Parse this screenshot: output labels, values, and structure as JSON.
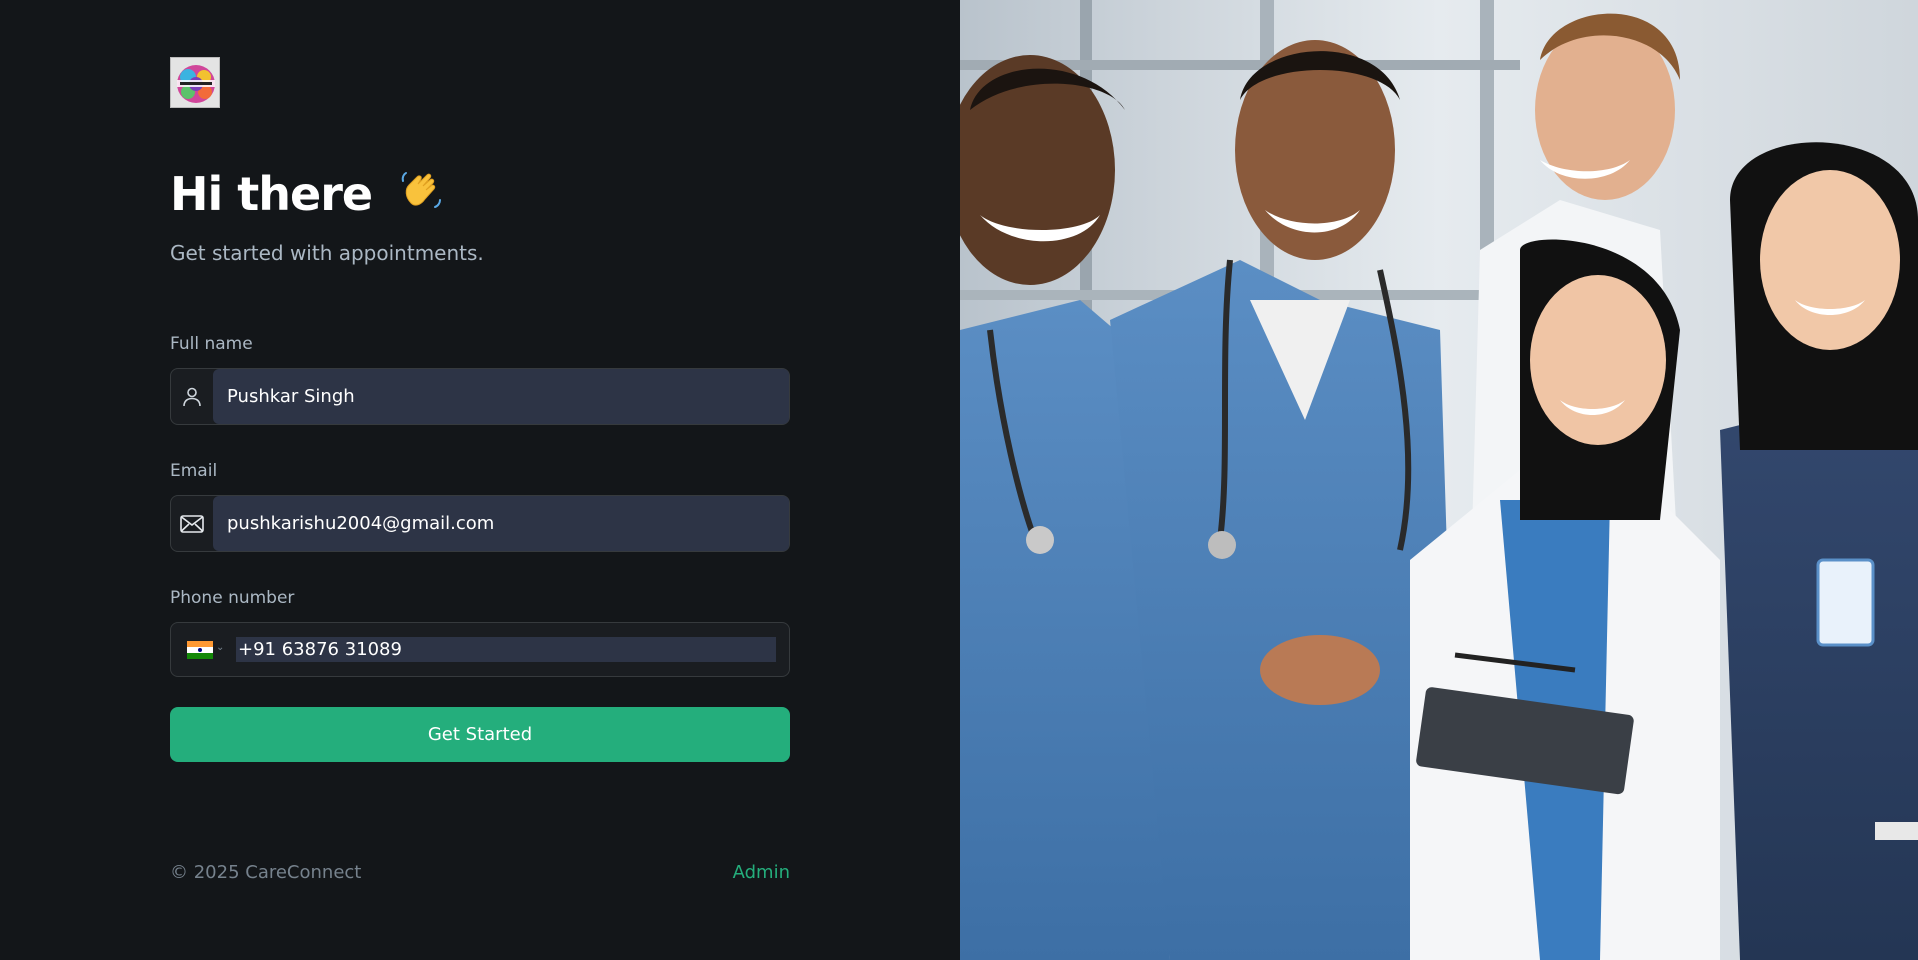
{
  "brand": {
    "logo_alt": "CareConnect logo"
  },
  "hero": {
    "title": "Hi there",
    "wave_icon": "waving-hand-icon",
    "subtitle": "Get started with appointments."
  },
  "form": {
    "full_name": {
      "label": "Full name",
      "value": "Pushkar Singh",
      "icon": "user-icon"
    },
    "email": {
      "label": "Email",
      "value": "pushkarishu2004@gmail.com",
      "icon": "mail-icon"
    },
    "phone": {
      "label": "Phone number",
      "value": "+91 63876 31089",
      "country_icon": "india-flag-icon"
    },
    "submit_label": "Get Started"
  },
  "footer": {
    "copyright": "© 2025 CareConnect",
    "admin_link": "Admin"
  },
  "colors": {
    "background": "#131619",
    "input_fill": "#2d3446",
    "accent": "#24ae7c",
    "muted_text": "#abb8c4"
  },
  "side_image": {
    "subject": "smiling medical team in scrubs and lab coats"
  }
}
